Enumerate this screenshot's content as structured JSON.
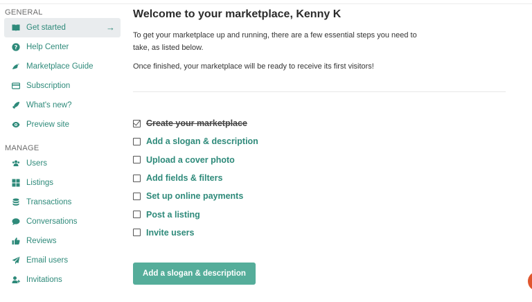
{
  "sidebar": {
    "general_title": "GENERAL",
    "manage_title": "MANAGE",
    "general_items": [
      {
        "label": "Get started",
        "icon": "book-icon",
        "active": true
      },
      {
        "label": "Help Center",
        "icon": "question-icon"
      },
      {
        "label": "Marketplace Guide",
        "icon": "bird-icon"
      },
      {
        "label": "Subscription",
        "icon": "credit-card-icon"
      },
      {
        "label": "What's new?",
        "icon": "rocket-icon"
      },
      {
        "label": "Preview site",
        "icon": "eye-icon"
      }
    ],
    "manage_items": [
      {
        "label": "Users",
        "icon": "users-icon"
      },
      {
        "label": "Listings",
        "icon": "grid-icon"
      },
      {
        "label": "Transactions",
        "icon": "database-icon"
      },
      {
        "label": "Conversations",
        "icon": "chat-icon"
      },
      {
        "label": "Reviews",
        "icon": "thumbs-up-icon"
      },
      {
        "label": "Email users",
        "icon": "paper-plane-icon"
      },
      {
        "label": "Invitations",
        "icon": "user-plus-icon"
      }
    ],
    "active_arrow": "→"
  },
  "main": {
    "title": "Welcome to your marketplace, Kenny K",
    "intro": "To get your marketplace up and running, there are a few essential steps you need to take, as listed below.",
    "intro2": "Once finished, your marketplace will be ready to receive its first visitors!",
    "checklist": [
      {
        "label": "Create your marketplace",
        "done": true
      },
      {
        "label": "Add a slogan & description",
        "done": false
      },
      {
        "label": "Upload a cover photo",
        "done": false
      },
      {
        "label": "Add fields & filters",
        "done": false
      },
      {
        "label": "Set up online payments",
        "done": false
      },
      {
        "label": "Post a listing",
        "done": false
      },
      {
        "label": "Invite users",
        "done": false
      }
    ],
    "cta_label": "Add a slogan & description"
  },
  "colors": {
    "accent": "#2e8a7a",
    "button": "#55ad9a",
    "active_bg": "#e9ecee",
    "fab": "#e0562e"
  }
}
